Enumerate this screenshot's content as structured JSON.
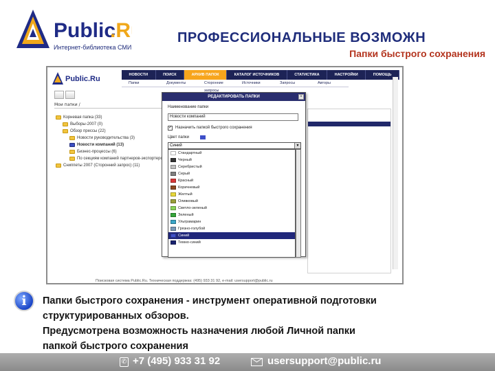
{
  "brand": {
    "logo_text": "Public.Ru",
    "tagline": "Интернет-библиотека СМИ"
  },
  "title": "ПРОФЕССИОНАЛЬНЫЕ ВОЗМОЖН",
  "subtitle": "Папки быстрого сохранения",
  "app": {
    "nav_tabs": [
      "НОВОСТИ",
      "ПОИСК",
      "АРХИВ ПАПОК",
      "КАТАЛОГ ИСТОЧНИКОВ",
      "СТАТИСТИКА",
      "НАСТРОЙКИ",
      "ПОМОЩЬ"
    ],
    "subnav": [
      "Папки",
      "Документы",
      "Сторонние запросы",
      "Источники",
      "Запросы",
      "Авторы"
    ],
    "breadcrumb": "Мои папки /",
    "tree": [
      {
        "label": "Корневая папка (33)"
      },
      {
        "label": "Выборы-2007 (0)"
      },
      {
        "label": "Обзор прессы (22)"
      },
      {
        "label": "Новости руководительства (3)"
      },
      {
        "label": "Новости компаний (13)"
      },
      {
        "label": "Бизнес-процессы (6)"
      },
      {
        "label": "По секциям компаний партнеров-экспортеров (3)"
      },
      {
        "label": "Сниппеты 2007 (Сторонний запрос) (11)"
      }
    ],
    "dialog": {
      "title": "РЕДАКТИРОВАТЬ ПАПКИ",
      "close_icon": "×",
      "name_label": "Наименование папки",
      "name_value": "Новости компаний",
      "checkbox_label": "Назначить папкой быстрого сохранения",
      "color_label": "Цвет папки",
      "color_value": "Синий",
      "colors": [
        {
          "label": "Стандартный",
          "color": "#ffffff"
        },
        {
          "label": "Черный",
          "color": "#333333"
        },
        {
          "label": "Серебристый",
          "color": "#c0c0c0"
        },
        {
          "label": "Серый",
          "color": "#7f7f7f"
        },
        {
          "label": "Красный",
          "color": "#d83838"
        },
        {
          "label": "Коричневый",
          "color": "#8c4a23"
        },
        {
          "label": "Желтый",
          "color": "#e8d83a"
        },
        {
          "label": "Оливковый",
          "color": "#9aa03a"
        },
        {
          "label": "Светло-зеленый",
          "color": "#8ad45a"
        },
        {
          "label": "Зеленый",
          "color": "#35a63a"
        },
        {
          "label": "Ультрамарин",
          "color": "#3aa6c8"
        },
        {
          "label": "Грязно-голубой",
          "color": "#7a9ab8"
        },
        {
          "label": "Синий",
          "color": "#3e4fc8",
          "selected": true
        },
        {
          "label": "Темно-синий",
          "color": "#1a2370"
        }
      ]
    },
    "footer": "Поисковая система Public.Ru. Техническая поддержка: (495) 933 31 92, e-mail: usersupport@public.ru"
  },
  "description": {
    "line1": "Папки быстрого сохранения - инструмент оперативной подготовки",
    "line2": "структурированных обзоров.",
    "line3": "Предусмотрена возможность назначения любой Личной папки",
    "line4": "папкой быстрого сохранения"
  },
  "contacts": {
    "phone": "+7 (495) 933 31 92",
    "email": "usersupport@public.ru"
  }
}
